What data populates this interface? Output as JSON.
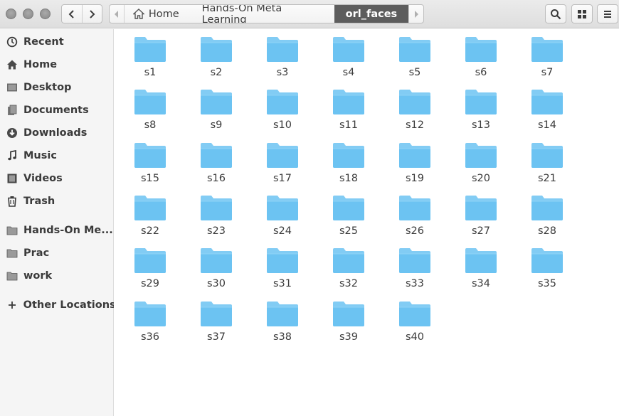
{
  "window": {
    "controls": [
      "close",
      "minimize",
      "maximize"
    ]
  },
  "navigation": {
    "back_icon": "chevron-left-icon",
    "forward_icon": "chevron-right-icon"
  },
  "pathbar": {
    "home_label": "Home",
    "crumbs": [
      "Hands-On Meta Learning",
      "orl_faces"
    ],
    "active_index": 1
  },
  "toolbar": {
    "search_icon": "search-icon",
    "view_icon": "grid-view-icon",
    "menu_icon": "hamburger-menu-icon"
  },
  "sidebar": {
    "items": [
      {
        "label": "Recent",
        "icon": "clock-icon"
      },
      {
        "label": "Home",
        "icon": "home-icon"
      },
      {
        "label": "Desktop",
        "icon": "desktop-icon"
      },
      {
        "label": "Documents",
        "icon": "documents-icon"
      },
      {
        "label": "Downloads",
        "icon": "downloads-icon"
      },
      {
        "label": "Music",
        "icon": "music-icon"
      },
      {
        "label": "Videos",
        "icon": "videos-icon"
      },
      {
        "label": "Trash",
        "icon": "trash-icon"
      },
      {
        "label": "Hands-On Me...",
        "icon": "folder-icon"
      },
      {
        "label": "Prac",
        "icon": "folder-icon"
      },
      {
        "label": "work",
        "icon": "folder-icon"
      },
      {
        "label": "Other Locations",
        "icon": "plus-icon"
      }
    ]
  },
  "folders": [
    "s1",
    "s2",
    "s3",
    "s4",
    "s5",
    "s6",
    "s7",
    "s8",
    "s9",
    "s10",
    "s11",
    "s12",
    "s13",
    "s14",
    "s15",
    "s16",
    "s17",
    "s18",
    "s19",
    "s20",
    "s21",
    "s22",
    "s23",
    "s24",
    "s25",
    "s26",
    "s27",
    "s28",
    "s29",
    "s30",
    "s31",
    "s32",
    "s33",
    "s34",
    "s35",
    "s36",
    "s37",
    "s38",
    "s39",
    "s40"
  ],
  "colors": {
    "folder": "#6cc3f2",
    "active_crumb": "#5d5d5d"
  }
}
